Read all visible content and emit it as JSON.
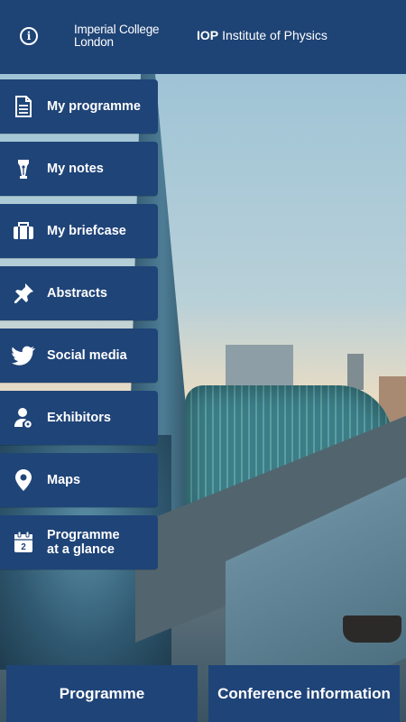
{
  "header": {
    "info_icon": "info-icon",
    "imperial_line1": "Imperial College",
    "imperial_line2": "London",
    "iop_abbr": "IOP",
    "iop_name": "Institute of Physics"
  },
  "menu": {
    "items": [
      {
        "label": "My programme",
        "icon": "document-icon"
      },
      {
        "label": "My notes",
        "icon": "pen-nib-icon"
      },
      {
        "label": "My briefcase",
        "icon": "briefcase-icon"
      },
      {
        "label": "Abstracts",
        "icon": "pushpin-icon"
      },
      {
        "label": "Social media",
        "icon": "twitter-bird-icon"
      },
      {
        "label": "Exhibitors",
        "icon": "exhibitor-person-icon"
      },
      {
        "label": "Maps",
        "icon": "map-pin-icon"
      },
      {
        "label": "Programme\nat a glance",
        "icon": "calendar-icon",
        "calendar_day": "2"
      }
    ]
  },
  "bottom": {
    "programme_label": "Programme",
    "conference_label": "Conference information"
  },
  "colors": {
    "primary": "#1f4478",
    "header": "#1e4375",
    "text": "#ffffff"
  }
}
